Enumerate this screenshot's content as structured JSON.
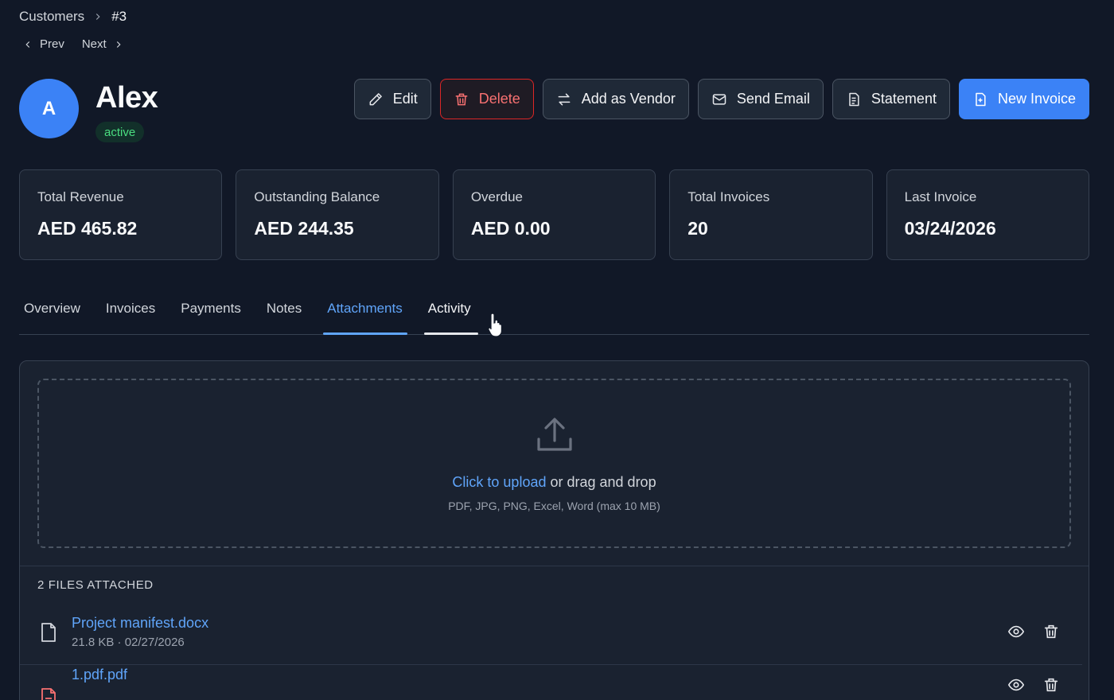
{
  "breadcrumb": {
    "parent": "Customers",
    "current": "#3"
  },
  "pager": {
    "prev": "Prev",
    "next": "Next"
  },
  "customer": {
    "initial": "A",
    "name": "Alex",
    "status": "active"
  },
  "actions": {
    "edit": "Edit",
    "delete": "Delete",
    "add_vendor": "Add as Vendor",
    "send_email": "Send Email",
    "statement": "Statement",
    "new_invoice": "New Invoice"
  },
  "stats": [
    {
      "label": "Total Revenue",
      "value": "AED 465.82"
    },
    {
      "label": "Outstanding Balance",
      "value": "AED 244.35"
    },
    {
      "label": "Overdue",
      "value": "AED 0.00"
    },
    {
      "label": "Total Invoices",
      "value": "20"
    },
    {
      "label": "Last Invoice",
      "value": "03/24/2026"
    }
  ],
  "tabs": [
    "Overview",
    "Invoices",
    "Payments",
    "Notes",
    "Attachments",
    "Activity"
  ],
  "active_tab": "Attachments",
  "upload": {
    "link_text": "Click to upload",
    "rest_text": " or drag and drop",
    "hint": "PDF, JPG, PNG, Excel, Word (max 10 MB)"
  },
  "files": {
    "header": "2 FILES ATTACHED",
    "items": [
      {
        "name": "Project manifest.docx",
        "meta": "21.8 KB · 02/27/2026",
        "icon": "document-icon"
      },
      {
        "name": "1.pdf.pdf",
        "meta": "",
        "icon": "pdf-file-icon"
      }
    ]
  },
  "colors": {
    "background": "#111827",
    "card": "#1a2230",
    "accent": "#3b82f6",
    "link": "#60a5fa",
    "danger": "#f87171",
    "success": "#4ade80"
  }
}
